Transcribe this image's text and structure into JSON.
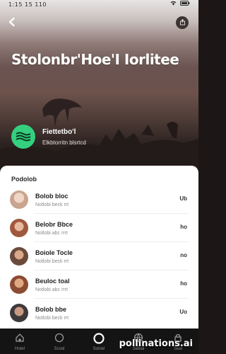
{
  "status_bar": {
    "left": "1:15 15 110",
    "right_icons": [
      "wifi-icon",
      "battery-icon"
    ]
  },
  "hero": {
    "title": "Stolonbr'Hoe'I Iorlitee",
    "back_icon": "back-arrow-icon",
    "action_icon": "share-icon"
  },
  "profile": {
    "name": "Fiettetbo'l",
    "subtitle": "Elkbtorritn blsrtcd"
  },
  "section": {
    "title": "Podolob"
  },
  "list": [
    {
      "title": "Bolob bloc",
      "subtitle": "Notlobi beck rrt",
      "meta": "Ub",
      "avatar_color": "#c9a48e"
    },
    {
      "title": "Belobr Bbce",
      "subtitle": "Notlobi abc rrrt",
      "meta": "ho",
      "avatar_color": "#a0583f"
    },
    {
      "title": "Boiole Tocle",
      "subtitle": "Notlobi beck rrt",
      "meta": "no",
      "avatar_color": "#6b4a3c"
    },
    {
      "title": "Beuloc toal",
      "subtitle": "Notlobi abc rrrt",
      "meta": "ho",
      "avatar_color": "#8c4b33"
    },
    {
      "title": "Bolob bbe",
      "subtitle": "Notlobi beck rrt",
      "meta": "Uo",
      "avatar_color": "#3e3a3c"
    }
  ],
  "nav": [
    {
      "label": "Hotel",
      "icon": "home-icon"
    },
    {
      "label": "Scool",
      "icon": "circle-icon"
    },
    {
      "label": "Soniel",
      "icon": "record-icon"
    },
    {
      "label": "Selbal",
      "icon": "globe-icon"
    },
    {
      "label": "Seal",
      "icon": "lock-icon"
    }
  ],
  "watermark": "pollinations.ai",
  "colors": {
    "accent": "#35d07f",
    "nav_bg": "#141414",
    "sheet_bg": "#ffffff"
  }
}
